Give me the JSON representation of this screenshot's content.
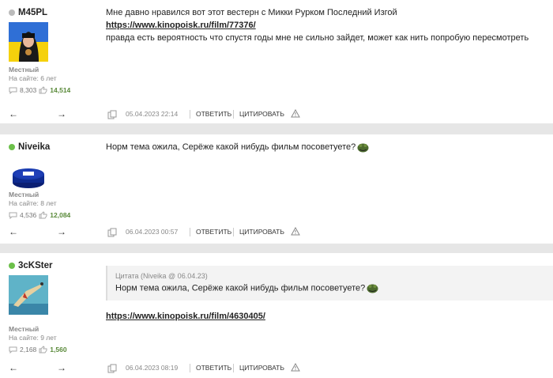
{
  "posts": [
    {
      "username": "M45PL",
      "status_color": "#bbbbbb",
      "role": "Местный",
      "since": "На сайте: 6 лет",
      "messages": "8,303",
      "likes": "14,514",
      "text1": "Мне давно нравился вот этот вестерн с Микки Рурком Последний Изгой",
      "link": "https://www.kinopoisk.ru/film/77376/",
      "text2": "правда есть вероятность что спустя годы мне не сильно зайдет, может как нить попробую пересмотреть",
      "date": "05.04.2023 22:14",
      "reply": "ОТВЕТИТЬ",
      "quote": "ЦИТИРОВАТЬ"
    },
    {
      "username": "Niveika",
      "status_color": "#6cc04a",
      "role": "Местный",
      "since": "На сайте: 8 лет",
      "messages": "4,536",
      "likes": "12,084",
      "text1": "Норм тема ожила, Серёже какой нибудь фильм посоветуете?",
      "date": "06.04.2023 00:57",
      "reply": "ОТВЕТИТЬ",
      "quote": "ЦИТИРОВАТЬ"
    },
    {
      "username": "3cKSter",
      "status_color": "#6cc04a",
      "role": "Местный",
      "since": "На сайте: 9 лет",
      "messages": "2,168",
      "likes": "1,560",
      "quote_header": "Цитата (Niveika @ 06.04.23)",
      "quote_text": "Норм тема ожила, Серёже какой нибудь фильм посоветуете?",
      "link": "https://www.kinopoisk.ru/film/4630405/",
      "date": "06.04.2023 08:19",
      "reply": "ОТВЕТИТЬ",
      "quote": "ЦИТИРОВАТЬ"
    }
  ],
  "nav": {
    "prev": "←",
    "next": "→"
  }
}
